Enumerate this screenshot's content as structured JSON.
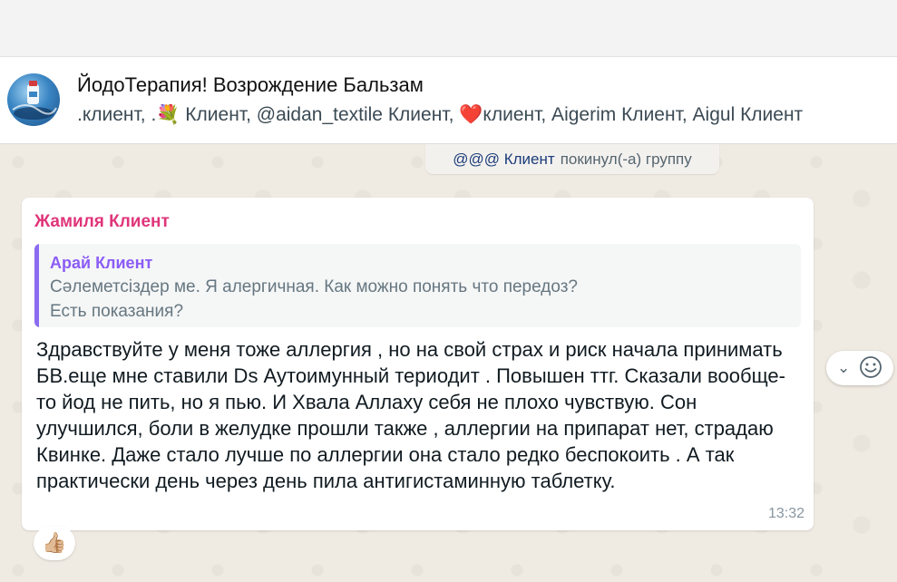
{
  "header": {
    "group_name": "ЙодоТерапия! Возрождение Бальзам",
    "members": ".клиент, .💐 Клиент, @aidan_textile Клиент, ❤️клиент, Aigerim Клиент, Aigul Клиент"
  },
  "system_message": {
    "who": "@@@ Клиент",
    "action": "покинул(-а) группу"
  },
  "message": {
    "sender": "Жамиля Клиент",
    "quote": {
      "author": "Арай Клиент",
      "text": "Сәлеметсіздер ме. Я алергичная. Как можно понять что передоз?\nЕсть показания?"
    },
    "text": "Здравствуйте у меня тоже аллергия , но на свой страх и риск начала принимать БВ.еще мне ставили Ds Аутоимунный териодит . Повышен ттг. Сказали вообще-то йод не пить, но я пью. И Хвала Аллаху себя не плохо чувствую. Сон улучшился,  боли в желудке прошли также , аллергии на припарат нет, страдаю Квинке. Даже стало лучше по аллергии она стало редко беспокоить . А так практически день через день пила антигистаминную таблетку.",
    "time": "13:32",
    "reaction": "👍🏼"
  },
  "icons": {
    "dropdown": "chevron-down-icon",
    "emoji": "smiley-icon"
  },
  "colors": {
    "sender_name": "#e0357a",
    "quote_author": "#8b5cf6",
    "chat_background": "#efeae2"
  }
}
